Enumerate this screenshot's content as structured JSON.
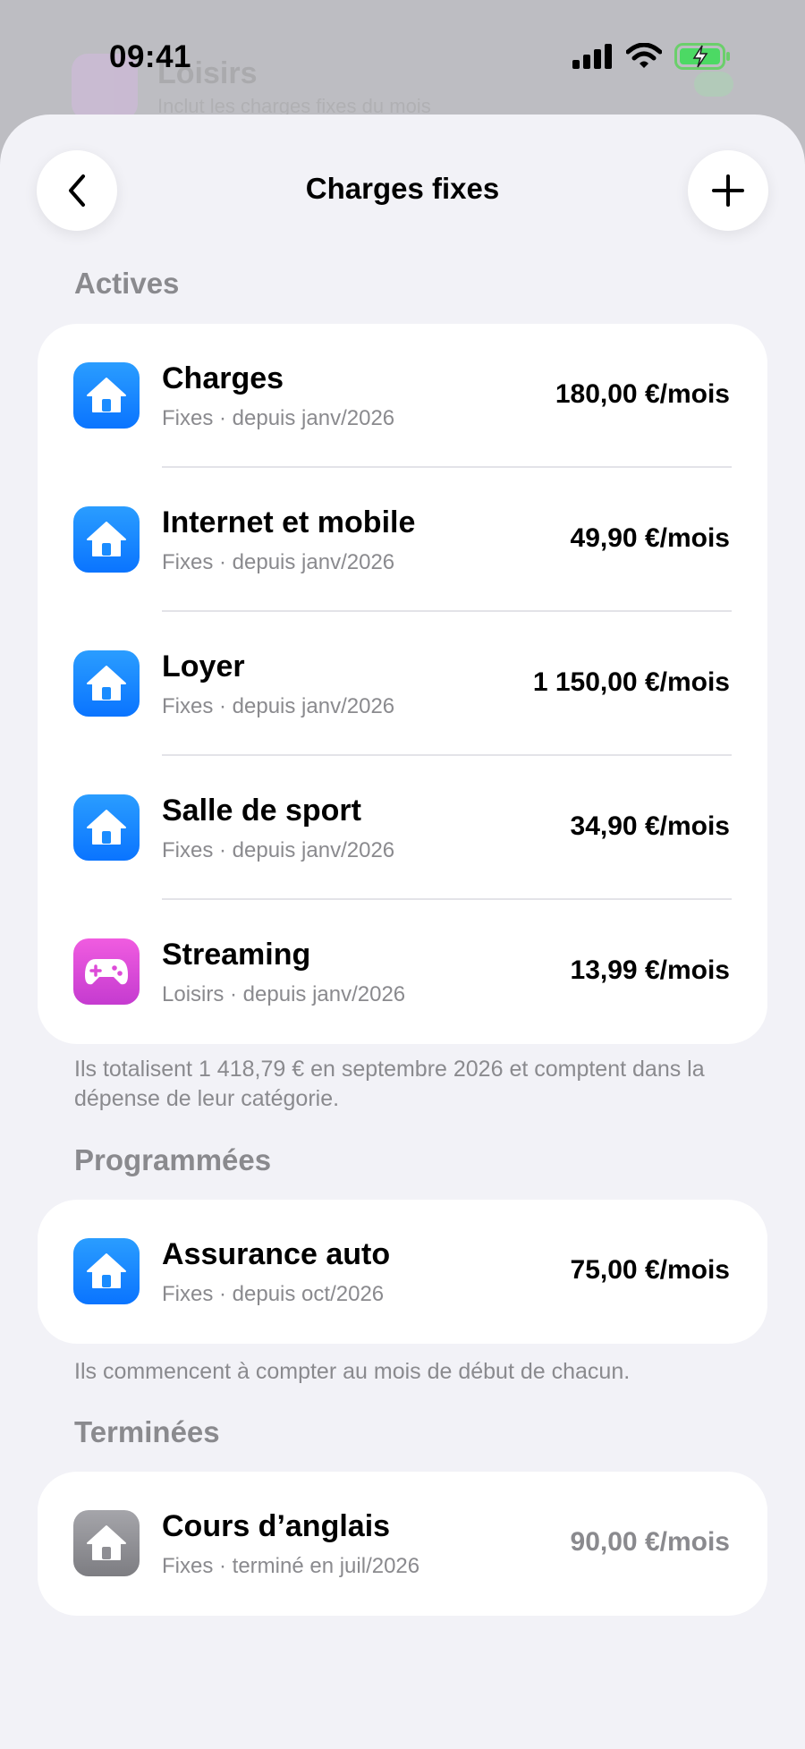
{
  "background": {
    "title": "Loisirs",
    "subtitle": "Inclut les charges fixes du mois"
  },
  "status_bar": {
    "time": "09:41",
    "icons": [
      "signal-icon",
      "wifi-icon",
      "battery-charging-icon"
    ]
  },
  "nav": {
    "title": "Charges fixes",
    "back_icon": "chevron-left-icon",
    "add_icon": "plus-icon"
  },
  "sections": {
    "active": {
      "header": "Actives",
      "items": [
        {
          "title": "Charges",
          "subtitle": "Fixes · depuis janv/2026",
          "amount": "180,00 €/mois",
          "icon": "house-icon",
          "color": "#1a8cff"
        },
        {
          "title": "Internet et mobile",
          "subtitle": "Fixes · depuis janv/2026",
          "amount": "49,90 €/mois",
          "icon": "house-icon",
          "color": "#1a8cff"
        },
        {
          "title": "Loyer",
          "subtitle": "Fixes · depuis janv/2026",
          "amount": "1 150,00 €/mois",
          "icon": "house-icon",
          "color": "#1a8cff"
        },
        {
          "title": "Salle de sport",
          "subtitle": "Fixes · depuis janv/2026",
          "amount": "34,90 €/mois",
          "icon": "house-icon",
          "color": "#1a8cff"
        },
        {
          "title": "Streaming",
          "subtitle": "Loisirs · depuis janv/2026",
          "amount": "13,99 €/mois",
          "icon": "gamepad-icon",
          "color": "#dd4bd8"
        }
      ],
      "footer": "Ils totalisent 1 418,79 € en septembre 2026 et comptent dans la dépense de leur catégorie."
    },
    "scheduled": {
      "header": "Programmées",
      "items": [
        {
          "title": "Assurance auto",
          "subtitle": "Fixes · depuis oct/2026",
          "amount": "75,00 €/mois",
          "icon": "house-icon",
          "color": "#1a8cff"
        }
      ],
      "footer": "Ils commencent à compter au mois de début de chacun."
    },
    "ended": {
      "header": "Terminées",
      "items": [
        {
          "title": "Cours d’anglais",
          "subtitle": "Fixes · terminé en juil/2026",
          "amount": "90,00 €/mois",
          "icon": "house-icon",
          "color": "#8e8e93"
        }
      ]
    }
  }
}
